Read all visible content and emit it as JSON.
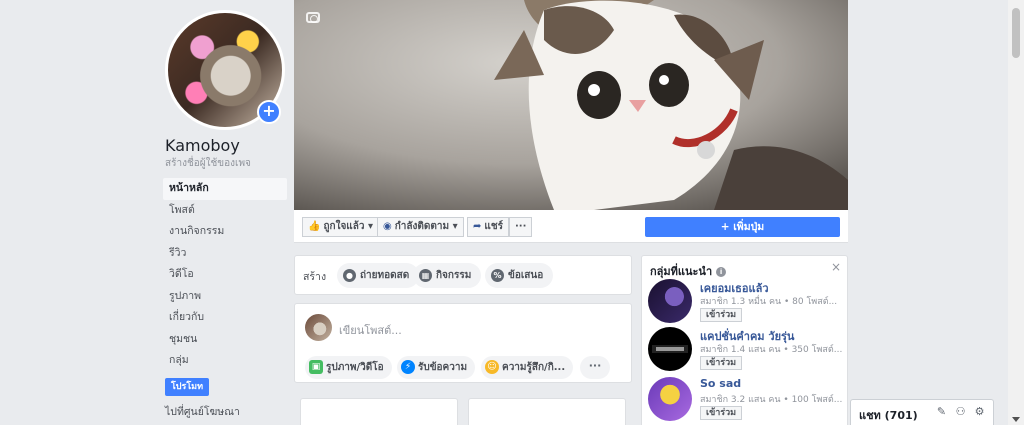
{
  "page": {
    "name": "Kamoboy",
    "username_prompt": "สร้างชื่อผู้ใช้ของเพจ",
    "add_photo_icon": "plus"
  },
  "sidebar": {
    "items": [
      {
        "label": "หน้าหลัก",
        "active": true
      },
      {
        "label": "โพสต์"
      },
      {
        "label": "งานกิจกรรม"
      },
      {
        "label": "รีวิว"
      },
      {
        "label": "วิดีโอ"
      },
      {
        "label": "รูปภาพ"
      },
      {
        "label": "เกี่ยวกับ"
      },
      {
        "label": "ชุมชน"
      },
      {
        "label": "กลุ่ม"
      }
    ],
    "promote_label": "โปรโมท",
    "ads_center_label": "ไปที่ศูนย์โฆษณา"
  },
  "cover": {
    "camera_icon": "camera-icon"
  },
  "action_bar": {
    "like_label": "ถูกใจแล้ว",
    "follow_label": "กำลังติดตาม",
    "share_label": "แชร์",
    "more_label": "···",
    "add_button_label": "+ เพิ่มปุ่ม"
  },
  "create": {
    "label": "สร้าง",
    "live_label": "ถ่ายทอดสด",
    "event_label": "กิจกรรม",
    "offer_label": "ข้อเสนอ"
  },
  "composer": {
    "placeholder": "เขียนโพสต์...",
    "photo_video_label": "รูปภาพ/วิดีโอ",
    "messages_label": "รับข้อความ",
    "feeling_label": "ความรู้สึก/กิ...",
    "more_label": "···"
  },
  "suggested_groups": {
    "title": "กลุ่มที่แนะนำ",
    "groups": [
      {
        "name": "เคยอมเธอแล้ว",
        "meta": "สมาชิก 1.3 หมื่น คน • 80 โพสต์...",
        "join_label": "เข้าร่วม"
      },
      {
        "name": "แคปชั่นคำคม วัยรุ่น",
        "meta": "สมาชิก 1.4 แสน คน • 350 โพสต์...",
        "join_label": "เข้าร่วม"
      },
      {
        "name": "So sad",
        "meta": "สมาชิก 3.2 แสน คน • 100 โพสต์...",
        "join_label": "เข้าร่วม"
      }
    ]
  },
  "chat": {
    "label": "แชท (701)"
  }
}
